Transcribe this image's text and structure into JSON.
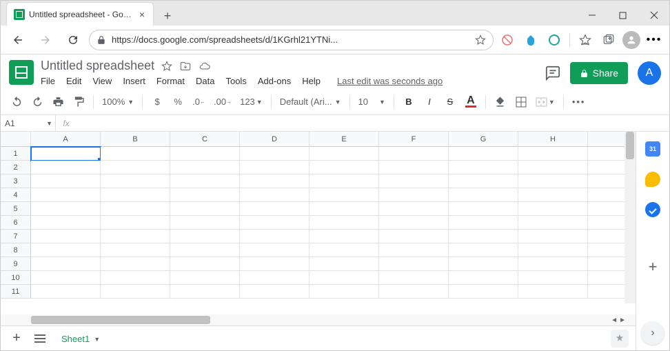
{
  "browser": {
    "tab_title": "Untitled spreadsheet - Google Sh",
    "url": "https://docs.google.com/spreadsheets/d/1KGrhl21YTNi..."
  },
  "header": {
    "doc_title": "Untitled spreadsheet",
    "menus": [
      "File",
      "Edit",
      "View",
      "Insert",
      "Format",
      "Data",
      "Tools",
      "Add-ons",
      "Help"
    ],
    "edit_info": "Last edit was seconds ago",
    "share_label": "Share",
    "avatar_letter": "A"
  },
  "toolbar": {
    "zoom": "100%",
    "num123": "123",
    "font": "Default (Ari...",
    "font_size": "10",
    "text_color_letter": "A"
  },
  "formula": {
    "name_box": "A1",
    "fx": "fx",
    "value": ""
  },
  "grid": {
    "columns": [
      "A",
      "B",
      "C",
      "D",
      "E",
      "F",
      "G",
      "H"
    ],
    "rows": [
      "1",
      "2",
      "3",
      "4",
      "5",
      "6",
      "7",
      "8",
      "9",
      "10",
      "11"
    ],
    "selected": "A1"
  },
  "sheet_tabs": {
    "active": "Sheet1"
  },
  "side_panel": {
    "calendar_label": "31"
  }
}
